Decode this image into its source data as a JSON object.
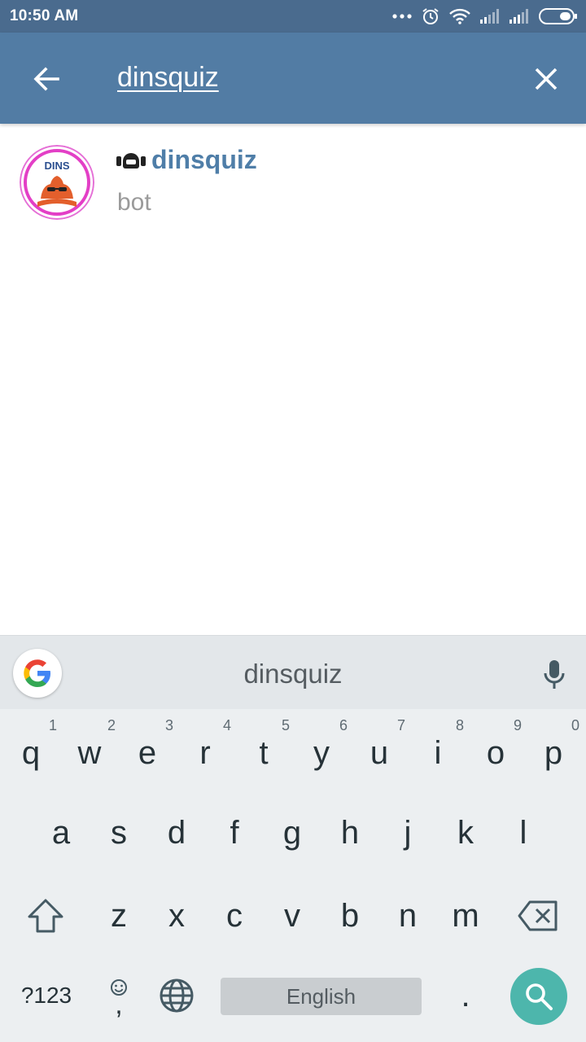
{
  "status_bar": {
    "time": "10:50 AM",
    "icons": [
      "more-dots-icon",
      "alarm-icon",
      "wifi-icon",
      "signal-icon",
      "signal-icon-2",
      "battery-icon"
    ]
  },
  "app_bar": {
    "back_icon": "arrow-left-icon",
    "search_value": "dinsquiz",
    "clear_icon": "close-icon",
    "color": "#527ca4"
  },
  "results": [
    {
      "name": "dinsquiz",
      "subtitle": "bot",
      "avatar_text": "DINS",
      "type_icon": "bot-icon"
    }
  ],
  "keyboard": {
    "suggestion": "dinsquiz",
    "row1": [
      {
        "key": "q",
        "hint": "1"
      },
      {
        "key": "w",
        "hint": "2"
      },
      {
        "key": "e",
        "hint": "3"
      },
      {
        "key": "r",
        "hint": "4"
      },
      {
        "key": "t",
        "hint": "5"
      },
      {
        "key": "y",
        "hint": "6"
      },
      {
        "key": "u",
        "hint": "7"
      },
      {
        "key": "i",
        "hint": "8"
      },
      {
        "key": "o",
        "hint": "9"
      },
      {
        "key": "p",
        "hint": "0"
      }
    ],
    "row2": [
      "a",
      "s",
      "d",
      "f",
      "g",
      "h",
      "j",
      "k",
      "l"
    ],
    "row3": [
      "z",
      "x",
      "c",
      "v",
      "b",
      "n",
      "m"
    ],
    "symbols_label": "?123",
    "comma_label": ",",
    "space_label": "English",
    "period_label": ".",
    "accent_color": "#4db6ac"
  }
}
